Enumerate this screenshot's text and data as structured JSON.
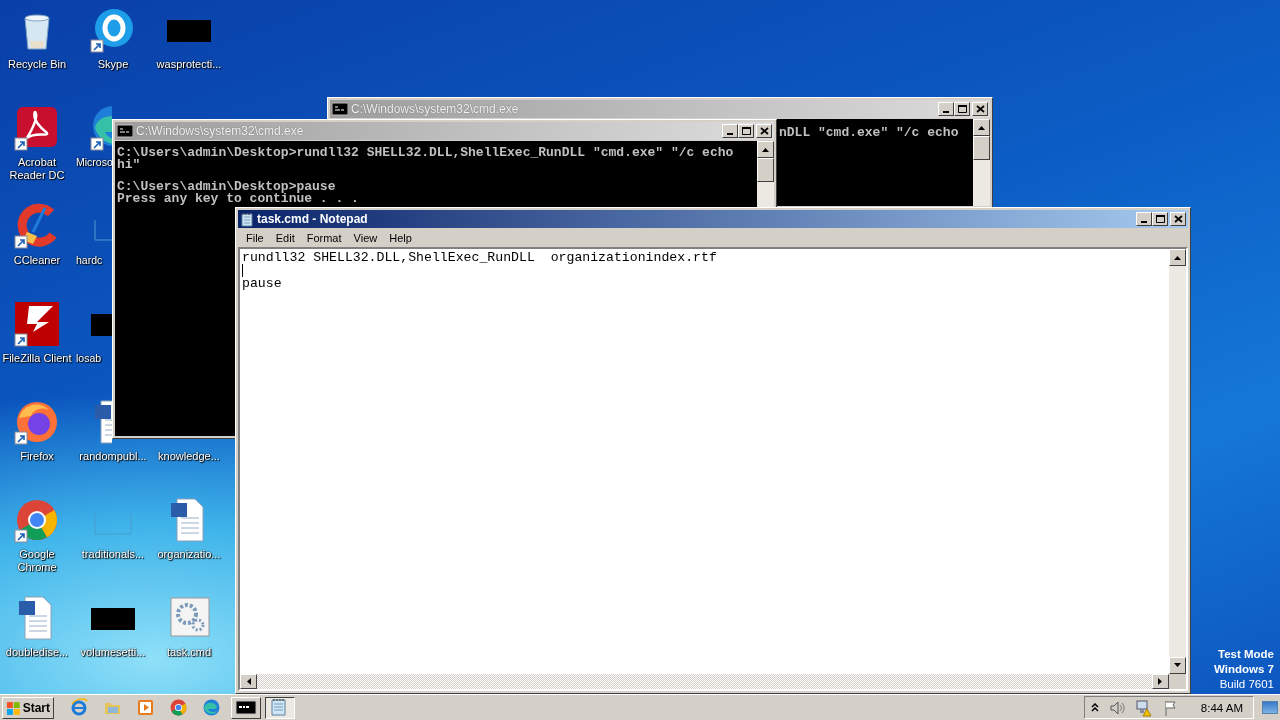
{
  "desktop": {
    "icons": [
      {
        "label": "Recycle Bin",
        "kind": "recycle",
        "shortcut": false,
        "clipped": false,
        "covered": false
      },
      {
        "label": "Skype",
        "kind": "chat",
        "shortcut": true,
        "clipped": false,
        "covered": false
      },
      {
        "label": "wasprotecti...",
        "kind": "dark",
        "shortcut": false,
        "clipped": false,
        "covered": false
      },
      {
        "label": "Acrobat Reader DC",
        "kind": "pdf",
        "shortcut": true,
        "clipped": false,
        "covered": false
      },
      {
        "label": "Microso",
        "kind": "edge",
        "shortcut": true,
        "clipped": true,
        "covered": true
      },
      {
        "label": "CCleaner",
        "kind": "brush",
        "shortcut": true,
        "clipped": false,
        "covered": false
      },
      {
        "label": "hardc",
        "kind": "blank",
        "shortcut": false,
        "clipped": true,
        "covered": true
      },
      {
        "label": "FileZilla Client",
        "kind": "transfer",
        "shortcut": true,
        "clipped": false,
        "covered": false
      },
      {
        "label": "losab",
        "kind": "dark",
        "shortcut": false,
        "clipped": true,
        "covered": true
      },
      {
        "label": "Firefox",
        "kind": "firefox",
        "shortcut": true,
        "clipped": false,
        "covered": false
      },
      {
        "label": "randompubl...",
        "kind": "word",
        "shortcut": false,
        "clipped": false,
        "covered": true
      },
      {
        "label": "knowledge...",
        "clipped": false
      },
      {
        "label": "Google Chrome",
        "kind": "chrome",
        "shortcut": true,
        "clipped": false,
        "covered": false
      },
      {
        "label": "traditionals...",
        "kind": "blank",
        "shortcut": false,
        "clipped": false,
        "covered": false
      },
      {
        "label": "organizatio...",
        "kind": "word",
        "shortcut": false,
        "clipped": false,
        "covered": false
      },
      {
        "label": "doubledise...",
        "kind": "word",
        "shortcut": false,
        "clipped": false,
        "covered": false
      },
      {
        "label": "volumesetti...",
        "kind": "dark",
        "shortcut": false,
        "clipped": false,
        "covered": false
      },
      {
        "label": "task.cmd",
        "kind": "gear",
        "shortcut": false,
        "clipped": false,
        "covered": false
      }
    ]
  },
  "windows": [
    {
      "kind": "console",
      "title": "C:\\Windows\\system32\\cmd.exe",
      "active": false,
      "blocks": [
        [
          "nDLL \"cmd.exe\" \"/c echo"
        ]
      ]
    },
    {
      "kind": "console",
      "title": "C:\\Windows\\system32\\cmd.exe",
      "active": false,
      "blocks": [
        [
          "C:\\Users\\admin\\Desktop>rundll32 SHELL32.DLL,ShellExec_RunDLL \"cmd.exe\" \"/c echo",
          "hi\""
        ],
        [
          "C:\\Users\\admin\\Desktop>pause",
          "Press any key to continue . . ."
        ]
      ]
    },
    {
      "kind": "notepad",
      "title": "task.cmd - Notepad",
      "active": true,
      "menu": [
        "File",
        "Edit",
        "Format",
        "View",
        "Help"
      ],
      "lines": [
        {
          "text": "rundll32 SHELL32.DLL,ShellExec_RunDLL  organizationindex.rtf",
          "caret": false
        },
        {
          "caret": true
        },
        {
          "text": "pause",
          "caret": false
        }
      ]
    }
  ],
  "system_notice": [
    "Test Mode",
    "Windows 7",
    "Build 7601"
  ],
  "taskbar": {
    "start": "Start",
    "quick_launch": [
      {
        "kind": "ie"
      },
      {
        "kind": "folder"
      },
      {
        "kind": "media"
      },
      {
        "kind": "chrome"
      },
      {
        "kind": "edge"
      }
    ],
    "tasks": [
      {
        "kind": "console",
        "selected": false
      },
      {
        "kind": "notepad",
        "selected": true
      }
    ],
    "tray": [
      {
        "kind": "chevron"
      },
      {
        "kind": "speaker"
      },
      {
        "kind": "network"
      },
      {
        "kind": "flag"
      }
    ],
    "clock": "8:44 AM"
  }
}
